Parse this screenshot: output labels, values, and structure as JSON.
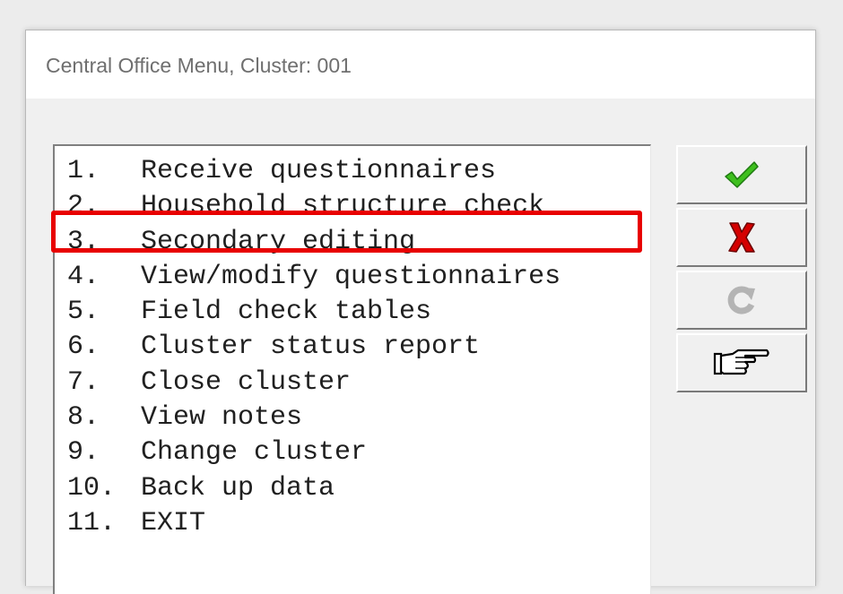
{
  "window": {
    "title": "Central Office Menu, Cluster: 001"
  },
  "menu": {
    "items": [
      {
        "num": "1.",
        "label": "Receive questionnaires"
      },
      {
        "num": "2.",
        "label": "Household structure check"
      },
      {
        "num": "3.",
        "label": "Secondary editing"
      },
      {
        "num": "4.",
        "label": "View/modify questionnaires"
      },
      {
        "num": "5.",
        "label": "Field check tables"
      },
      {
        "num": "6.",
        "label": "Cluster status report"
      },
      {
        "num": "7.",
        "label": "Close cluster"
      },
      {
        "num": "8.",
        "label": "View notes"
      },
      {
        "num": "9.",
        "label": "Change cluster"
      },
      {
        "num": "10.",
        "label": "Back up data"
      },
      {
        "num": "11.",
        "label": "EXIT"
      }
    ],
    "highlighted_item": "3. Secondary editing"
  },
  "buttons": [
    {
      "icon": "checkmark-icon",
      "color": "#3fbf1f"
    },
    {
      "icon": "red-x-icon",
      "color": "#d40000"
    },
    {
      "icon": "refresh-icon",
      "color": "#b4b4b4",
      "disabled": true
    },
    {
      "icon": "pointing-hand-icon",
      "color": "#000000"
    }
  ],
  "colors": {
    "highlight_border": "#e80000"
  }
}
